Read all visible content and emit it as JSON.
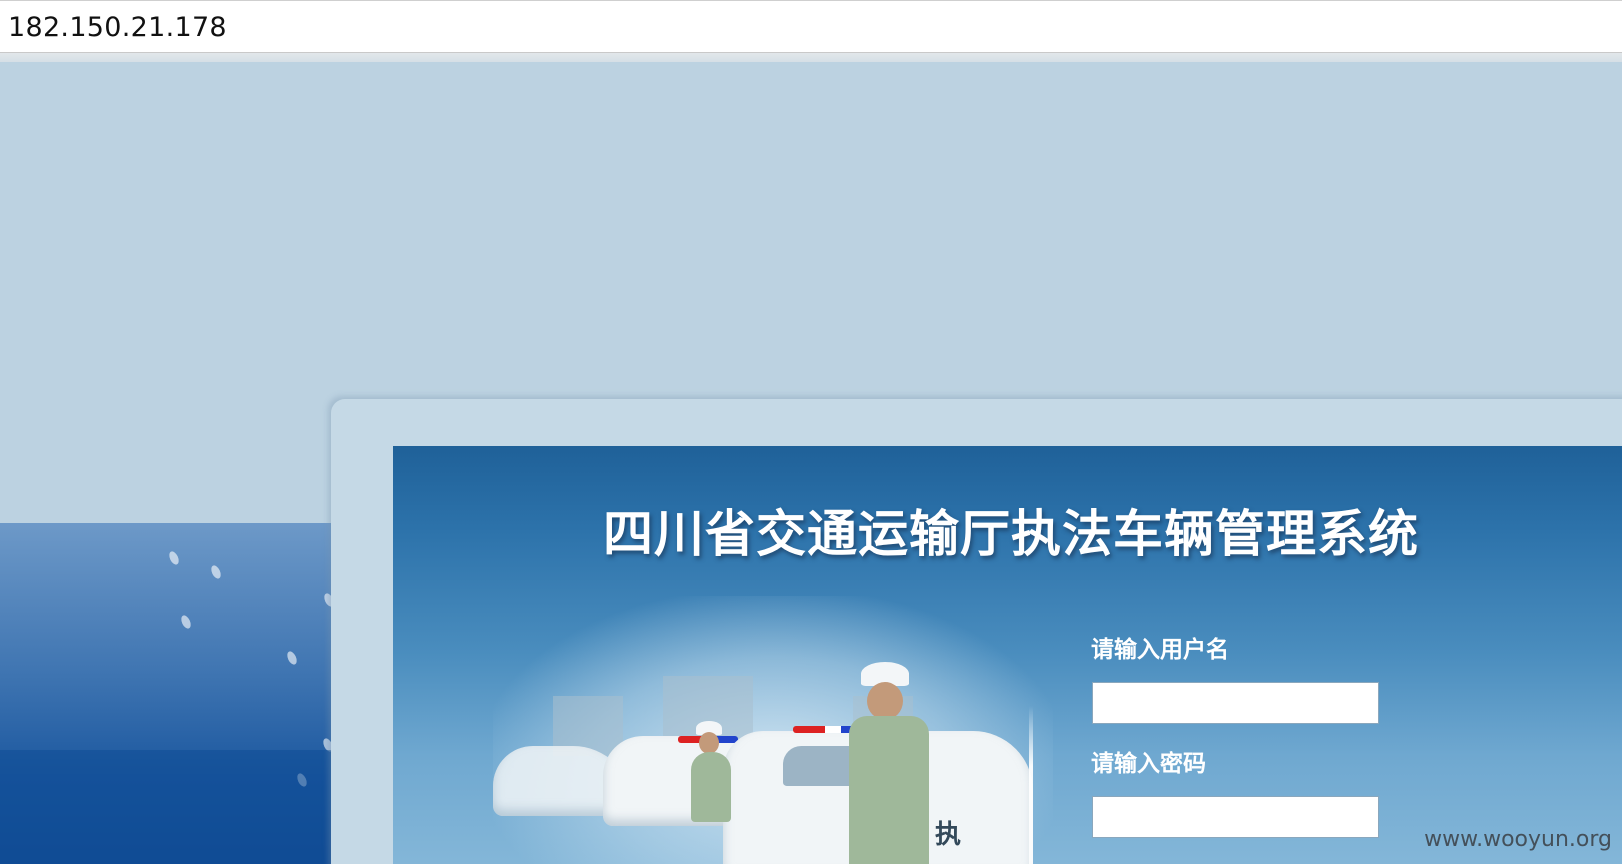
{
  "browser": {
    "address": "182.150.21.178"
  },
  "login": {
    "title": "四川省交通运输厅执法车辆管理系统",
    "username_label": "请输入用户名",
    "username_value": "",
    "password_label": "请输入密码",
    "password_value": "",
    "door_text": "执"
  },
  "watermark": "www.wooyun.org",
  "colors": {
    "page_background": "#bcd2e1",
    "panel_top": "#1f6199",
    "panel_bottom": "#86b8d9",
    "label_text": "#ffffff"
  }
}
